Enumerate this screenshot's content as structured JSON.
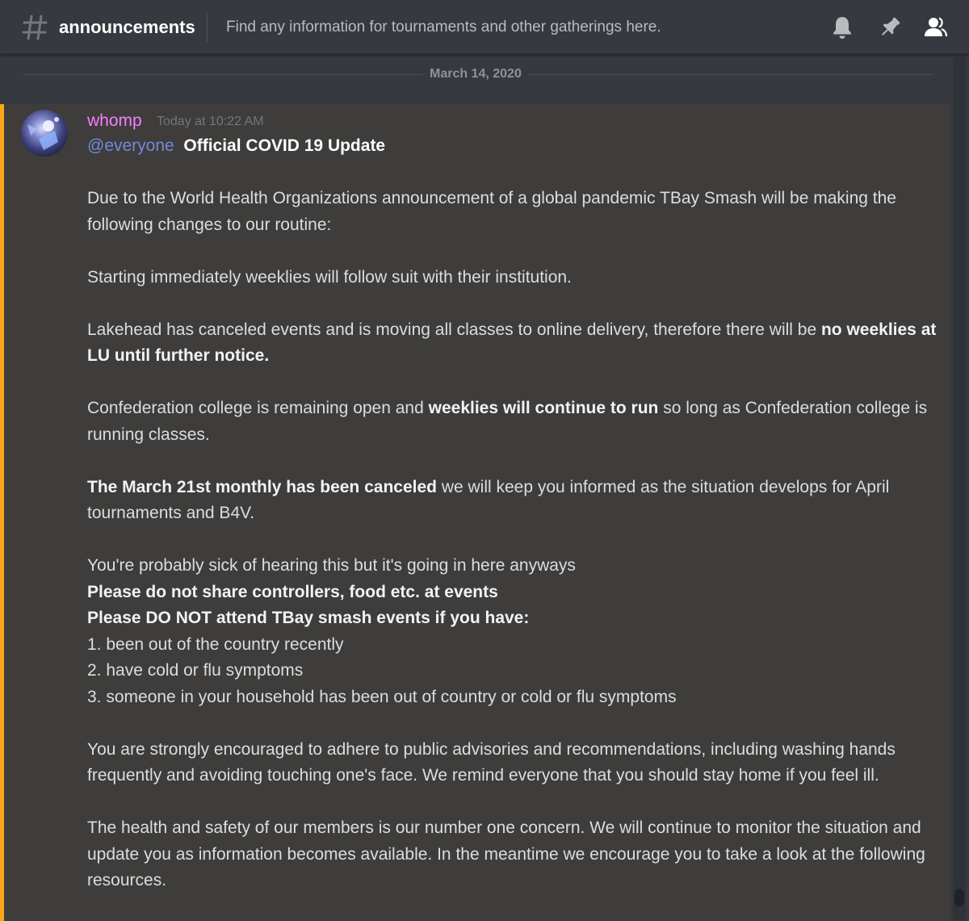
{
  "header": {
    "channel_name": "announcements",
    "topic": "Find any information for tournaments and other gatherings here.",
    "icons": [
      "hash-icon",
      "bell-icon",
      "pin-icon",
      "members-icon"
    ]
  },
  "divider": {
    "date": "March 14, 2020"
  },
  "message": {
    "author": "whomp",
    "author_color": "#f47fff",
    "timestamp": "Today at 10:22 AM",
    "mention": "@everyone",
    "title": "Official COVID 19 Update",
    "para1": "Due to the World Health Organizations announcement of a global pandemic TBay Smash will be making the following changes to our routine:",
    "para2": "Starting immediately weeklies will follow suit with their institution.",
    "para3_pre": "Lakehead has canceled events and is moving all classes to online delivery, therefore there will be ",
    "para3_bold": "no weeklies at LU until further notice.",
    "para4_pre": "Confederation college is remaining open and ",
    "para4_bold": "weeklies will continue to run",
    "para4_post": " so long as Confederation college is running classes.",
    "para5_bold": "The March 21st monthly has been canceled",
    "para5_post": " we will keep you informed as the situation develops for April tournaments and B4V.",
    "para6_line1": "You're probably sick of hearing this but it's going in here anyways",
    "para6_bold1": "Please do not share controllers, food etc. at events",
    "para6_bold2": "Please DO NOT attend TBay smash events if you have:",
    "list": [
      "1. been out of the country recently",
      "2. have cold or flu symptoms",
      "3. someone in your household has been out of country or cold or flu symptoms"
    ],
    "para7": "You are strongly encouraged to adhere to public advisories and recommendations, including washing hands frequently and avoiding touching one's face. We remind everyone that you should stay home if you feel ill.",
    "para8": "The health and safety of our members is our number one concern. We will continue to monitor the situation and update you as information becomes available. In the meantime we encourage you to take a look at the following resources."
  },
  "colors": {
    "background": "#36393f",
    "mention_highlight_bg": "#3e3d3b",
    "mention_bar": "#faa61a",
    "mention_text": "#7289da",
    "text": "#dcddde",
    "muted": "#72767d"
  }
}
